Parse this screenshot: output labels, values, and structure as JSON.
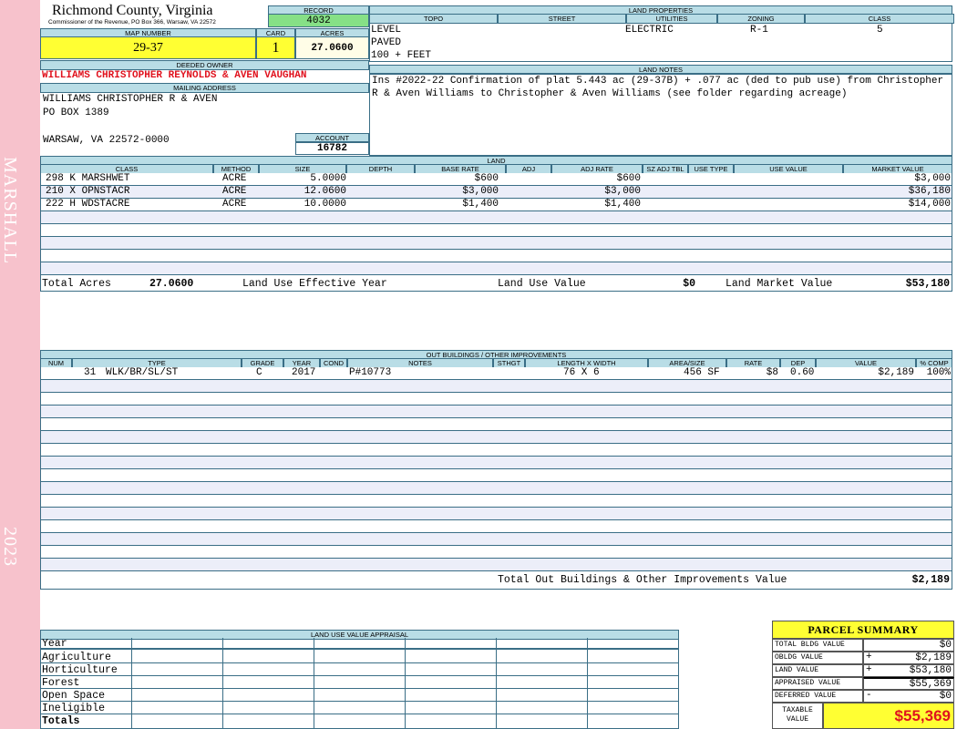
{
  "sidebar": {
    "top_text": "MARSHALL",
    "bottom_text": "2023"
  },
  "header": {
    "county": "Richmond County, Virginia",
    "commissioner": "Commissioner of the Revenue, PO Box 366, Warsaw, VA 22572",
    "record_label": "RECORD",
    "record": "4032",
    "map_label": "MAP NUMBER",
    "map": "29-37",
    "card_label": "CARD",
    "card": "1",
    "acres_label": "ACRES",
    "acres": "27.0600"
  },
  "owner": {
    "deeded_label": "DEEDED OWNER",
    "deeded": "WILLIAMS CHRISTOPHER REYNOLDS & AVEN VAUGHAN",
    "mailing_label": "MAILING ADDRESS",
    "line1": "WILLIAMS CHRISTOPHER R & AVEN",
    "line2": "PO BOX 1389",
    "line3": "WARSAW, VA 22572-0000",
    "account_label": "ACCOUNT",
    "account": "16782"
  },
  "land_properties": {
    "title": "LAND PROPERTIES",
    "cols": [
      "TOPO",
      "STREET",
      "UTILITIES",
      "ZONING",
      "CLASS"
    ],
    "topo": [
      "LEVEL",
      "PAVED",
      "100 + FEET"
    ],
    "utilities": "ELECTRIC",
    "zoning": "R-1",
    "class": "5"
  },
  "land_notes": {
    "title": "LAND NOTES",
    "text": "Ins #2022-22 Confirmation of plat 5.443 ac (29-37B) + .077 ac (ded to pub use) from Christopher R & Aven Williams to Christopher & Aven Williams (see folder regarding acreage)"
  },
  "land": {
    "title": "LAND",
    "cols": [
      "CLASS",
      "METHOD",
      "SIZE",
      "DEPTH",
      "BASE RATE",
      "ADJ",
      "ADJ RATE",
      "SZ ADJ TBL",
      "USE TYPE",
      "USE VALUE",
      "MARKET VALUE"
    ],
    "rows": [
      [
        "298 K MARSHWET",
        "ACRE",
        "5.0000",
        "",
        "$600",
        "",
        "$600",
        "",
        "",
        "",
        "$3,000"
      ],
      [
        "210 X OPNSTACR",
        "ACRE",
        "12.0600",
        "",
        "$3,000",
        "",
        "$3,000",
        "",
        "",
        "",
        "$36,180"
      ],
      [
        "222 H WDSTACRE",
        "ACRE",
        "10.0000",
        "",
        "$1,400",
        "",
        "$1,400",
        "",
        "",
        "",
        "$14,000"
      ]
    ],
    "total_acres_label": "Total Acres",
    "total_acres": "27.0600",
    "eff_year_label": "Land Use Effective Year",
    "use_value_label": "Land Use Value",
    "use_value": "$0",
    "market_label": "Land Market Value",
    "market": "$53,180"
  },
  "outbuildings": {
    "title": "OUT BUILDINGS / OTHER IMPROVEMENTS",
    "cols": [
      "NUM",
      "TYPE",
      "GRADE",
      "YEAR",
      "COND",
      "NOTES",
      "STHGT",
      "LENGTH X WIDTH",
      "AREA/SIZE",
      "RATE",
      "DEP",
      "VALUE",
      "% COMP"
    ],
    "rows": [
      [
        "31",
        "WLK/BR/SL/ST",
        "C",
        "2017",
        "",
        "P#10773",
        "",
        "76 X 6",
        "456 SF",
        "$8",
        "0.60",
        "$2,189",
        "100%"
      ]
    ],
    "total_label": "Total Out Buildings & Other Improvements Value",
    "total": "$2,189"
  },
  "land_use": {
    "title": "LAND USE VALUE APPRAISAL",
    "rows": [
      "Year",
      "Agriculture",
      "Horticulture",
      "Forest",
      "Open Space",
      "Ineligible",
      "Totals"
    ]
  },
  "parcel": {
    "title": "PARCEL SUMMARY",
    "rows": [
      {
        "label": "TOTAL BLDG VALUE",
        "sign": "",
        "value": "$0"
      },
      {
        "label": "OBLDG VALUE",
        "sign": "+",
        "value": "$2,189"
      },
      {
        "label": "LAND VALUE",
        "sign": "+",
        "value": "$53,180"
      },
      {
        "label": "APPRAISED VALUE",
        "sign": "",
        "value": "$55,369"
      },
      {
        "label": "DEFERRED VALUE",
        "sign": "-",
        "value": "$0"
      }
    ],
    "taxable_label": "TAXABLE VALUE",
    "taxable": "$55,369"
  }
}
